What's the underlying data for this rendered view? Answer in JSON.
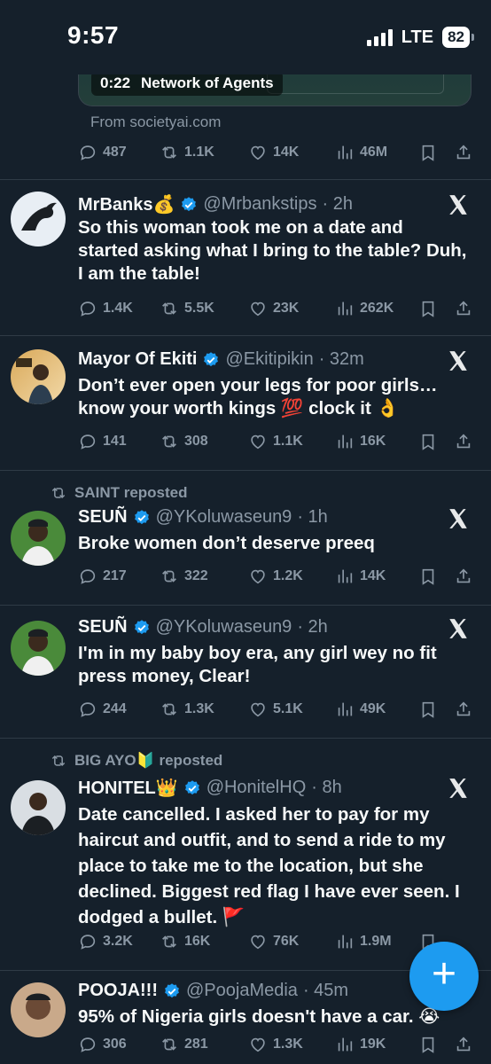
{
  "status_bar": {
    "time": "9:57",
    "network": "LTE",
    "battery": "82"
  },
  "top_media": {
    "time": "0:22",
    "title": "Network of Agents",
    "source": "From societyai.com"
  },
  "top_actions": {
    "replies": "487",
    "reposts": "1.1K",
    "likes": "14K",
    "views": "46M"
  },
  "tweets": [
    {
      "name": "MrBanks💰",
      "handle": "@Mrbankstips",
      "time": "· 2h",
      "text": "So this woman took me on a date and started asking what I bring to the table? Duh, I am the table!",
      "replies": "1.4K",
      "reposts": "5.5K",
      "likes": "23K",
      "views": "262K"
    },
    {
      "name": "Mayor Of Ekiti",
      "handle": "@Ekitipikin",
      "time": "· 32m",
      "text": "Don’t ever open your legs for poor girls… know your worth kings 💯 clock it 👌",
      "replies": "141",
      "reposts": "308",
      "likes": "1.1K",
      "views": "16K"
    },
    {
      "reposted_by": "SAINT reposted",
      "name": "SEUÑ",
      "handle": "@YKoluwaseun9",
      "time": "· 1h",
      "text": "Broke women don’t deserve preeq",
      "replies": "217",
      "reposts": "322",
      "likes": "1.2K",
      "views": "14K"
    },
    {
      "name": "SEUÑ",
      "handle": "@YKoluwaseun9",
      "time": "· 2h",
      "text": "I'm in my baby boy era, any girl wey no fit press money, Clear!",
      "replies": "244",
      "reposts": "1.3K",
      "likes": "5.1K",
      "views": "49K"
    },
    {
      "reposted_by": "BIG AYO🔰 reposted",
      "name": "HONITEL👑",
      "handle": "@HonitelHQ",
      "time": "· 8h",
      "text": "Date cancelled. I asked her to pay for my haircut and outfit, and to send a ride to my place to take me to the location, but she declined. Biggest red flag I have ever seen. I dodged a bullet. 🚩",
      "replies": "3.2K",
      "reposts": "16K",
      "likes": "76K",
      "views": "1.9M"
    },
    {
      "name": "POOJA!!!",
      "handle": "@PoojaMedia",
      "time": "· 45m",
      "text": "95% of Nigeria girls doesn't have a car. 😭",
      "replies": "306",
      "reposts": "281",
      "likes": "1.3K",
      "views": "19K"
    }
  ],
  "fab": {
    "label": "+"
  },
  "colors": {
    "background": "#15202b",
    "accent": "#1d9bf0",
    "muted": "#8b98a5"
  }
}
